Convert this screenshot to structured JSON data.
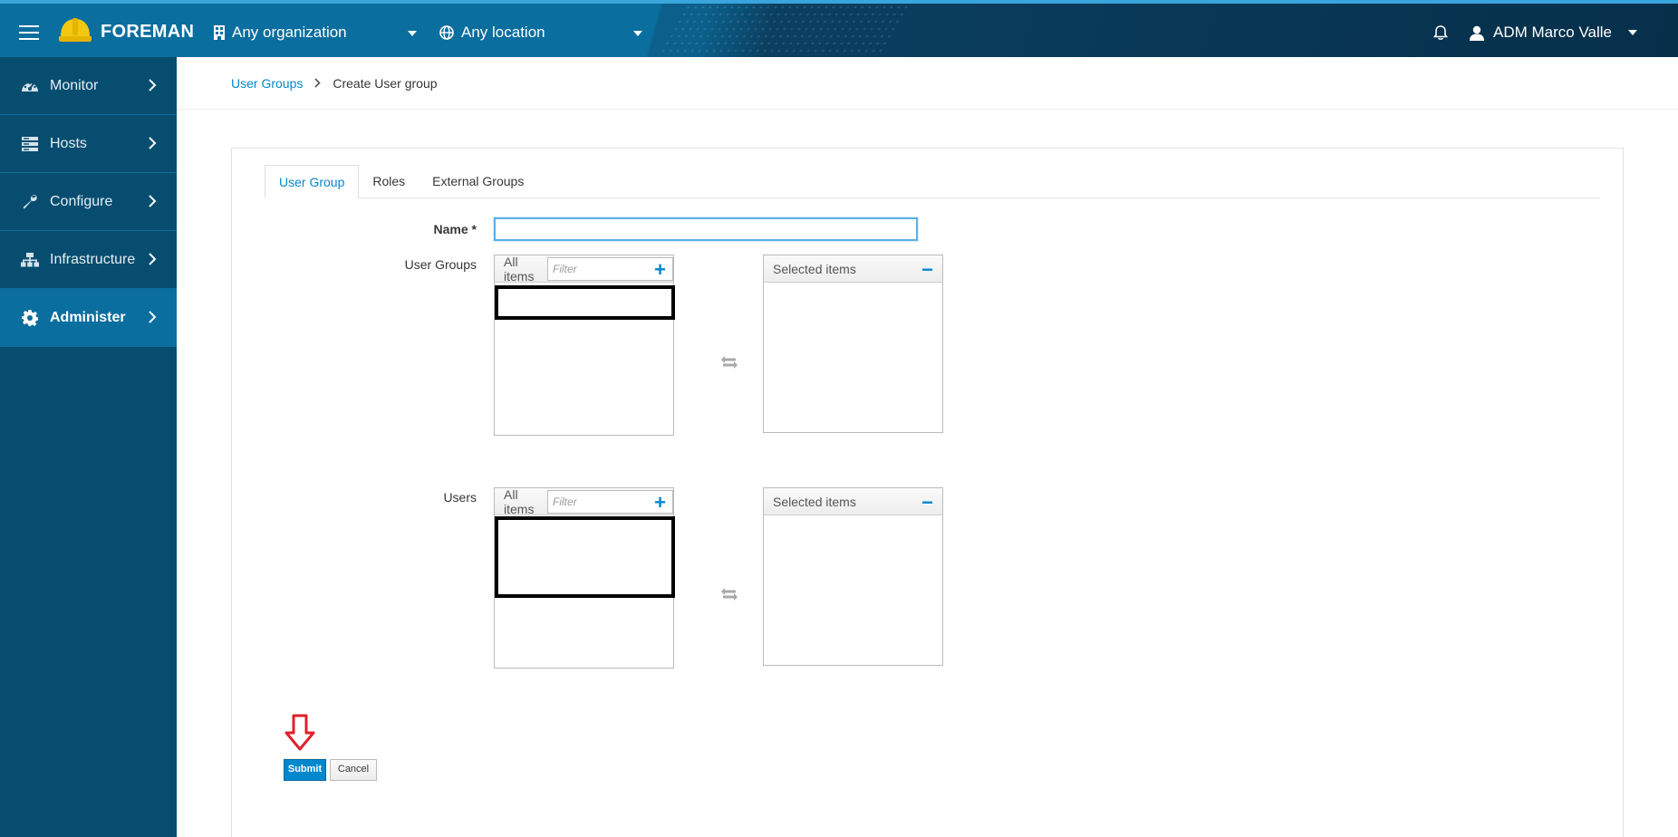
{
  "navbar": {
    "brand": "FOREMAN",
    "organization": "Any organization",
    "location": "Any location",
    "user": "ADM Marco Valle"
  },
  "sidebar": {
    "items": [
      {
        "label": "Monitor",
        "icon": "dashboard-icon"
      },
      {
        "label": "Hosts",
        "icon": "server-icon"
      },
      {
        "label": "Configure",
        "icon": "wrench-icon"
      },
      {
        "label": "Infrastructure",
        "icon": "network-icon"
      },
      {
        "label": "Administer",
        "icon": "gear-icon",
        "active": true
      }
    ]
  },
  "breadcrumb": {
    "parent": "User Groups",
    "current": "Create User group"
  },
  "tabs": [
    "User Group",
    "Roles",
    "External Groups"
  ],
  "form": {
    "name_label": "Name *",
    "name_value": "",
    "user_groups_label": "User Groups",
    "users_label": "Users",
    "all_items": "All items",
    "filter_placeholder": "Filter",
    "selected_items": "Selected items",
    "submit": "Submit",
    "cancel": "Cancel"
  },
  "colors": {
    "accent": "#0088ce",
    "navbar": "#0a6e9e",
    "sidebar": "#074d70",
    "annotation": "#e0202a"
  }
}
